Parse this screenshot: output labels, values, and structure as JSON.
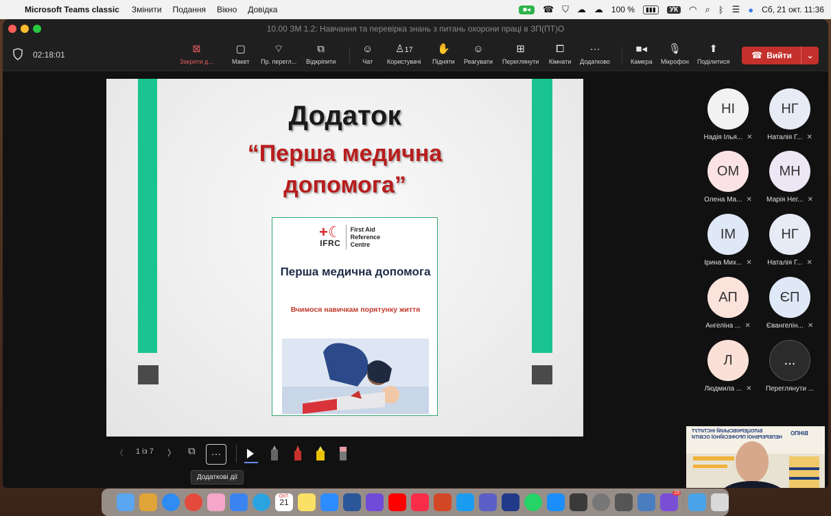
{
  "menubar": {
    "app_name": "Microsoft Teams classic",
    "items": [
      "Змінити",
      "Подання",
      "Вікно",
      "Довідка"
    ],
    "battery": "100 %",
    "keyboard": "УК",
    "datetime": "Сб, 21 окт.  11:36"
  },
  "window": {
    "title": "10.00 ЗМ 1.2: Навчання та перевірка знань з питань охорони праці в ЗП(ПТ)О"
  },
  "toolbar": {
    "timer": "02:18:01",
    "buttons": [
      {
        "label": "Закрити д...",
        "icon": "close-share-icon"
      },
      {
        "label": "Макет",
        "icon": "layout-icon"
      },
      {
        "label": "Пр. перегл...",
        "icon": "presenter-view-icon"
      },
      {
        "label": "Відкріпити",
        "icon": "popout-icon"
      },
      {
        "label": "Чат",
        "icon": "chat-icon"
      },
      {
        "label": "Користувачі",
        "icon": "people-icon"
      },
      {
        "label": "Підняти",
        "icon": "raise-hand-icon"
      },
      {
        "label": "Реагувати",
        "icon": "react-icon"
      },
      {
        "label": "Переглянути",
        "icon": "view-icon"
      },
      {
        "label": "Кімнати",
        "icon": "rooms-icon"
      },
      {
        "label": "Додатково",
        "icon": "more-icon"
      },
      {
        "label": "Камера",
        "icon": "camera-icon"
      },
      {
        "label": "Мікрофон",
        "icon": "microphone-icon"
      },
      {
        "label": "Поділитися",
        "icon": "share-icon"
      }
    ],
    "participants_count": "17",
    "leave_label": "Вийти",
    "accent": "#c4302b"
  },
  "slide": {
    "title": "Додаток",
    "subtitle": "“Перша медична допомога”",
    "card": {
      "logo_org": "IFRC",
      "logo_text": [
        "First Aid",
        "Reference",
        "Centre"
      ],
      "title": "Перша медична допомога",
      "subtitle": "Вчимося навичкам порятунку життя"
    },
    "colors": {
      "bars": "#19c490",
      "title_red": "#b81d1d"
    }
  },
  "slide_controls": {
    "page": "1 із 7",
    "more_tooltip": "Додаткові дії"
  },
  "participants": [
    {
      "initials": "НІ",
      "name": "Надія Ілья...",
      "color": "#f2f2f2"
    },
    {
      "initials": "НГ",
      "name": "Наталія Г...",
      "color": "#e6ebf5"
    },
    {
      "initials": "ОМ",
      "name": "Олена Ма...",
      "color": "#fbe3e3"
    },
    {
      "initials": "МН",
      "name": "Марія Нег...",
      "color": "#ece6f5"
    },
    {
      "initials": "ІМ",
      "name": "Ірина Мих...",
      "color": "#dfe8f7"
    },
    {
      "initials": "НГ",
      "name": "Наталія Г...",
      "color": "#e6ebf5"
    },
    {
      "initials": "АП",
      "name": "Ангеліна ...",
      "color": "#fbe3dc"
    },
    {
      "initials": "ЄП",
      "name": "Євангелін...",
      "color": "#dfe8f7"
    },
    {
      "initials": "Л",
      "name": "Людмила ...",
      "color": "#fbe0d8"
    },
    {
      "initials": "...",
      "name": "Переглянути ...",
      "color": "#2b2b2b"
    }
  ],
  "video": {
    "banner_logo": "ВІНПО",
    "banner_title": "БІЛОЦЕРКІВСЬКИЙ ІНСТИТУТ НЕПЕРЕРВНОЇ ПРОФЕСІЙНОЇ ОСВІТИ"
  },
  "dock": {
    "calendar_month": "ОКТ.",
    "calendar_day": "21",
    "badge": "23"
  }
}
